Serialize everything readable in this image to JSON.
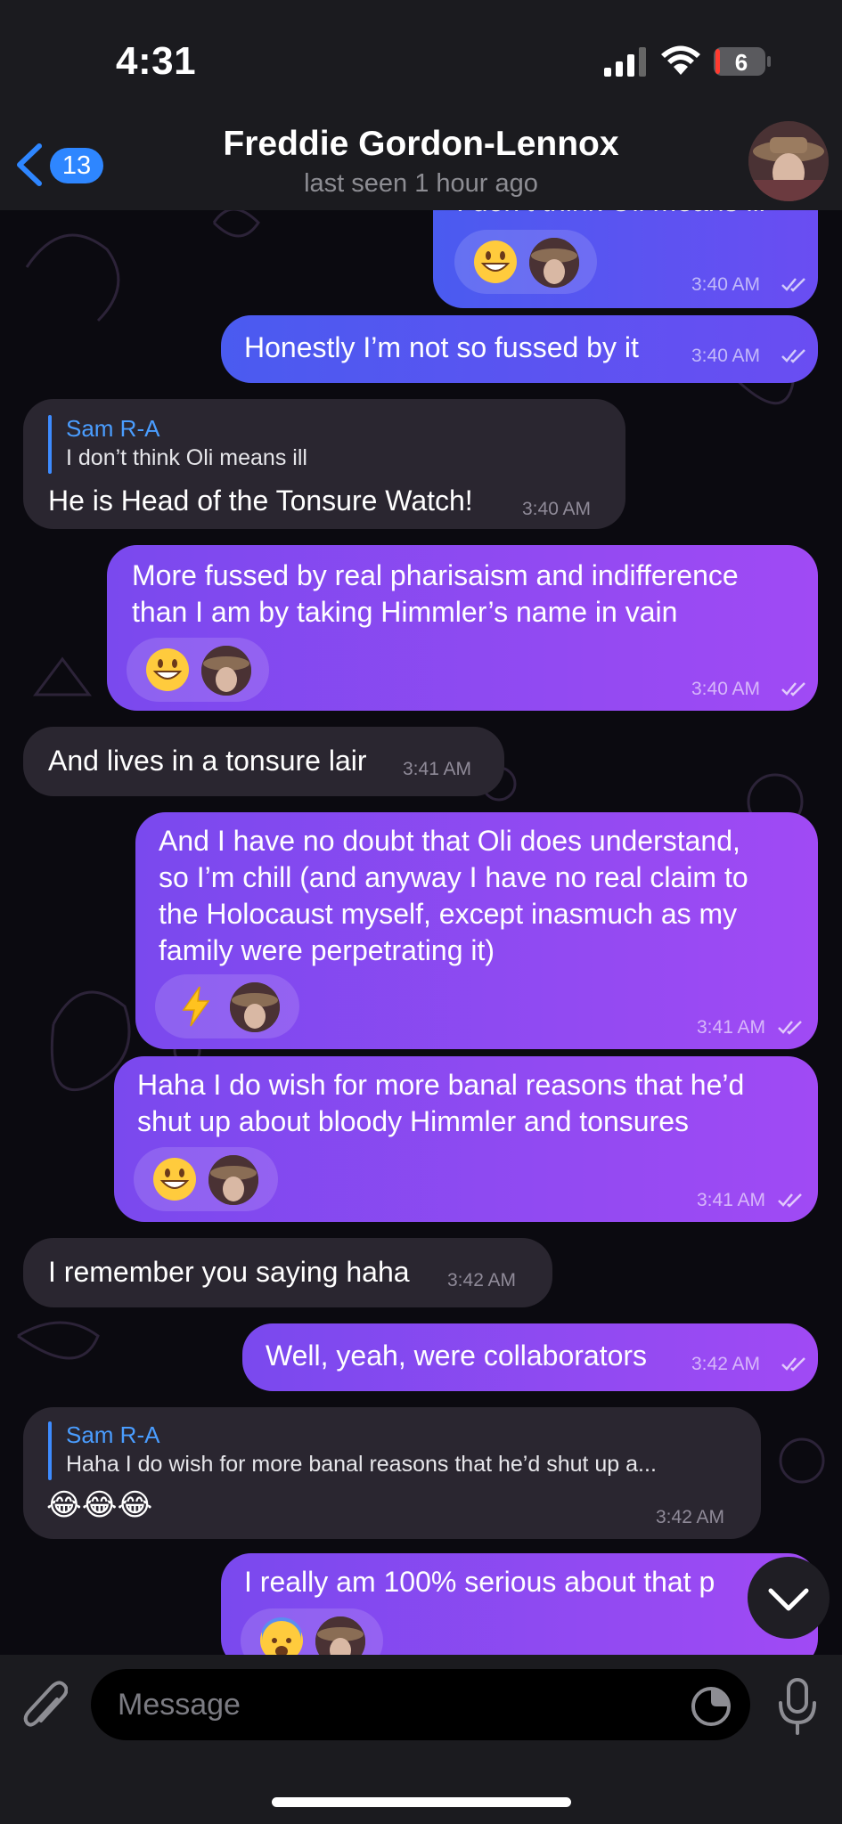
{
  "status_bar": {
    "time": "4:31",
    "battery_level": "6"
  },
  "header": {
    "back_count": "13",
    "contact_name": "Freddie Gordon-Lennox",
    "last_seen": "last seen 1 hour ago"
  },
  "colors": {
    "outgoing_bubble_start": "#7a49ee",
    "outgoing_bubble_end": "#a04af4",
    "incoming_bubble": "#2a2630",
    "reply_accent": "#4a9dff",
    "back_badge": "#2e86ff"
  },
  "messages": [
    {
      "direction": "out",
      "text": "I don’t think Oli means ill",
      "reactions": [
        "grinning-face",
        "avatar"
      ],
      "time": "3:40 AM",
      "read": true
    },
    {
      "direction": "out",
      "text": "Honestly I’m not so fussed by it",
      "time": "3:40 AM",
      "read": true
    },
    {
      "direction": "in",
      "reply_to": {
        "name": "Sam R-A",
        "text": "I don’t think Oli means ill"
      },
      "text": "He is Head of the Tonsure Watch!",
      "time": "3:40 AM"
    },
    {
      "direction": "out",
      "lines": [
        "More fussed by real pharisaism and indifference",
        "than I am by taking Himmler’s name in vain"
      ],
      "reactions": [
        "grinning-face",
        "avatar"
      ],
      "time": "3:40 AM",
      "read": true
    },
    {
      "direction": "in",
      "text": "And lives in a tonsure lair",
      "time": "3:41 AM"
    },
    {
      "direction": "out",
      "lines": [
        "And I have no doubt that Oli does understand,",
        "so I’m chill (and anyway I have no real claim to",
        "the Holocaust myself, except inasmuch as my",
        "family were perpetrating it)"
      ],
      "reactions": [
        "lightning",
        "avatar"
      ],
      "time": "3:41 AM",
      "read": true
    },
    {
      "direction": "out",
      "lines": [
        "Haha I do wish for more banal reasons that he’d",
        "shut up about bloody Himmler and tonsures"
      ],
      "reactions": [
        "grinning-face",
        "avatar"
      ],
      "time": "3:41 AM",
      "read": true
    },
    {
      "direction": "in",
      "text": "I remember you saying haha",
      "time": "3:42 AM"
    },
    {
      "direction": "out",
      "text": "Well, yeah, were collaborators",
      "time": "3:42 AM",
      "read": true
    },
    {
      "direction": "in",
      "reply_to": {
        "name": "Sam R-A",
        "text": "Haha I do wish for more banal reasons that he’d shut up a..."
      },
      "text": "😂😂😂",
      "time": "3:42 AM"
    },
    {
      "direction": "out",
      "text": "I really am 100% serious about that p",
      "reactions": [
        "fearful-face",
        "avatar"
      ]
    }
  ],
  "composer": {
    "placeholder": "Message"
  }
}
